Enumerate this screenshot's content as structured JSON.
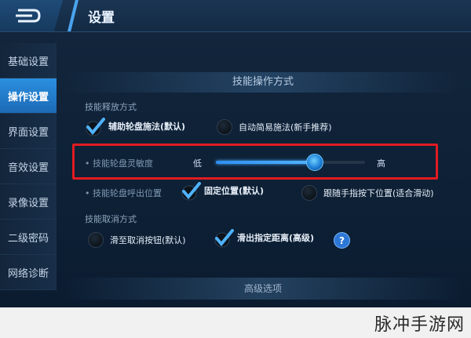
{
  "header": {
    "title": "设置"
  },
  "sidebar": {
    "items": [
      {
        "label": "基础设置",
        "active": false
      },
      {
        "label": "操作设置",
        "active": true
      },
      {
        "label": "界面设置",
        "active": false
      },
      {
        "label": "音效设置",
        "active": false
      },
      {
        "label": "录像设置",
        "active": false
      },
      {
        "label": "二级密码",
        "active": false
      },
      {
        "label": "网络诊断",
        "active": false
      }
    ]
  },
  "panel": {
    "title": "技能操作方式",
    "release": {
      "label": "技能释放方式",
      "option_wheel": "辅助轮盘施法(默认)",
      "option_wheel_checked": true,
      "option_simple": "自动简易施法(新手推荐)",
      "option_simple_checked": false
    },
    "sensitivity": {
      "label": "技能轮盘灵敏度",
      "low": "低",
      "high": "高",
      "level": 0.66
    },
    "wheel_position": {
      "label": "技能轮盘呼出位置",
      "option_fixed": "固定位置(默认)",
      "option_fixed_checked": true,
      "option_follow": "跟随手指按下位置(适合滑动)",
      "option_follow_checked": false
    },
    "cancel": {
      "label": "技能取消方式",
      "option_button": "滑至取消按钮(默认)",
      "option_button_checked": false,
      "option_distance": "滑出指定距离(高级)",
      "option_distance_checked": true,
      "help": "?"
    },
    "advanced": "高级选项"
  },
  "watermark": "脉冲手游网",
  "colors": {
    "accent": "#2b8fe0",
    "highlight": "#e11b22"
  },
  "icons": {
    "back": "back-arrow-icon",
    "check": "checkmark-icon",
    "help": "question-icon"
  }
}
